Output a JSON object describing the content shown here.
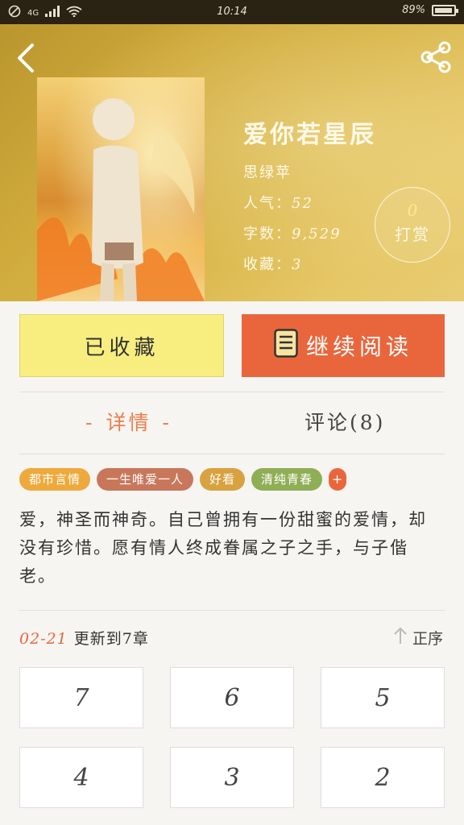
{
  "status_bar": {
    "network": "4G",
    "time": "10:14",
    "battery": "89%"
  },
  "book": {
    "title": "爱你若星辰",
    "author": "思绿苹",
    "popularity_label": "人气：",
    "popularity": "52",
    "words_label": "字数：",
    "words": "9,529",
    "favorites_label": "收藏：",
    "favorites": "3"
  },
  "reward": {
    "count": "0",
    "label": "打赏"
  },
  "actions": {
    "favorited_label": "已收藏",
    "continue_label": "继续阅读"
  },
  "tabs": {
    "detail": "详情",
    "comments": "评论(8)"
  },
  "tags": [
    {
      "label": "都市言情",
      "color": "#eea93c"
    },
    {
      "label": "一生唯爱一人",
      "color": "#c8775a"
    },
    {
      "label": "好看",
      "color": "#d8a240"
    },
    {
      "label": "清纯青春",
      "color": "#8fae55"
    },
    {
      "label": "+",
      "color": "#e9663c"
    }
  ],
  "description": "爱，神圣而神奇。自己曾拥有一份甜蜜的爱情，却没有珍惜。愿有情人终成眷属之子之手，与子偕老。",
  "update": {
    "date": "02-21",
    "text": "更新到7章"
  },
  "sort_label": "正序",
  "chapters": [
    "7",
    "6",
    "5",
    "4",
    "3",
    "2"
  ],
  "colors": {
    "accent": "#e9663c",
    "favorite_bg": "#f8ee80",
    "header_gold": "#cfa93a"
  }
}
